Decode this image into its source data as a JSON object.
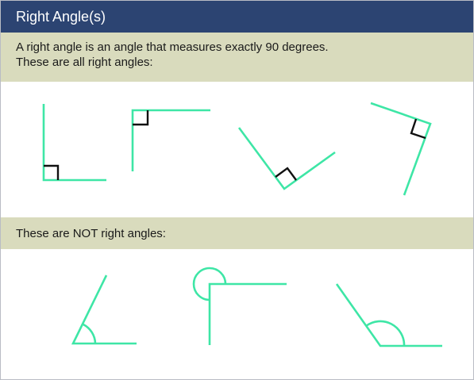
{
  "title": "Right Angle(s)",
  "intro": {
    "line1": "A right angle is an angle that measures exactly 90 degrees.",
    "line2": "These are all right angles:"
  },
  "not_right_heading": "These are NOT right angles:",
  "colors": {
    "header": "#2c4472",
    "band": "#d9dbbd",
    "ray": "#3ee6a6",
    "marker": "#111111"
  }
}
